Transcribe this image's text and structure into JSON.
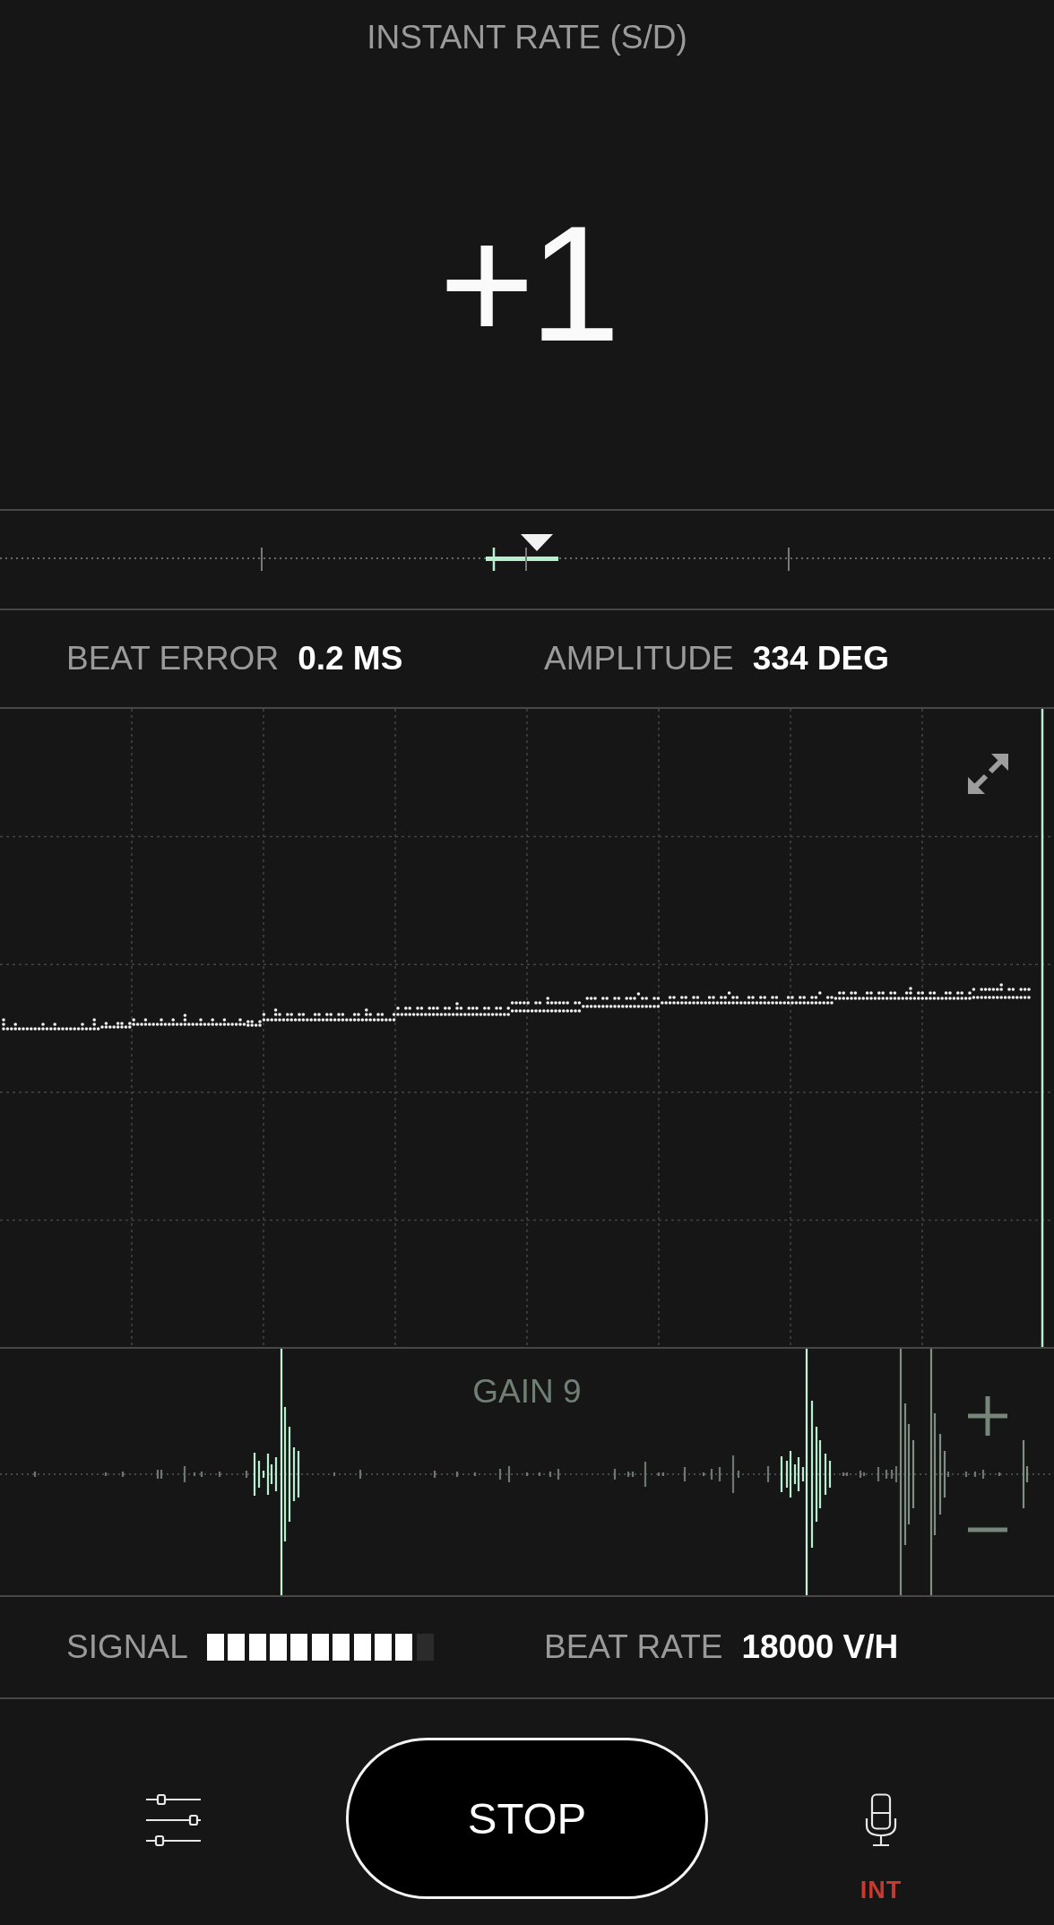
{
  "header": {
    "title": "INSTANT RATE (S/D)",
    "value": "+1"
  },
  "stats": [
    {
      "label": "BEAT ERROR",
      "value": "0.2 MS"
    },
    {
      "label": "AMPLITUDE",
      "value": "334 DEG"
    }
  ],
  "gain": {
    "label": "GAIN 9"
  },
  "readouts": [
    {
      "kind": "meter",
      "label": "SIGNAL",
      "level": 0.9
    },
    {
      "kind": "text",
      "label": "BEAT RATE",
      "value": "18000 V/H"
    }
  ],
  "controls": {
    "stop_button": "STOP",
    "input_source": "INT"
  }
}
